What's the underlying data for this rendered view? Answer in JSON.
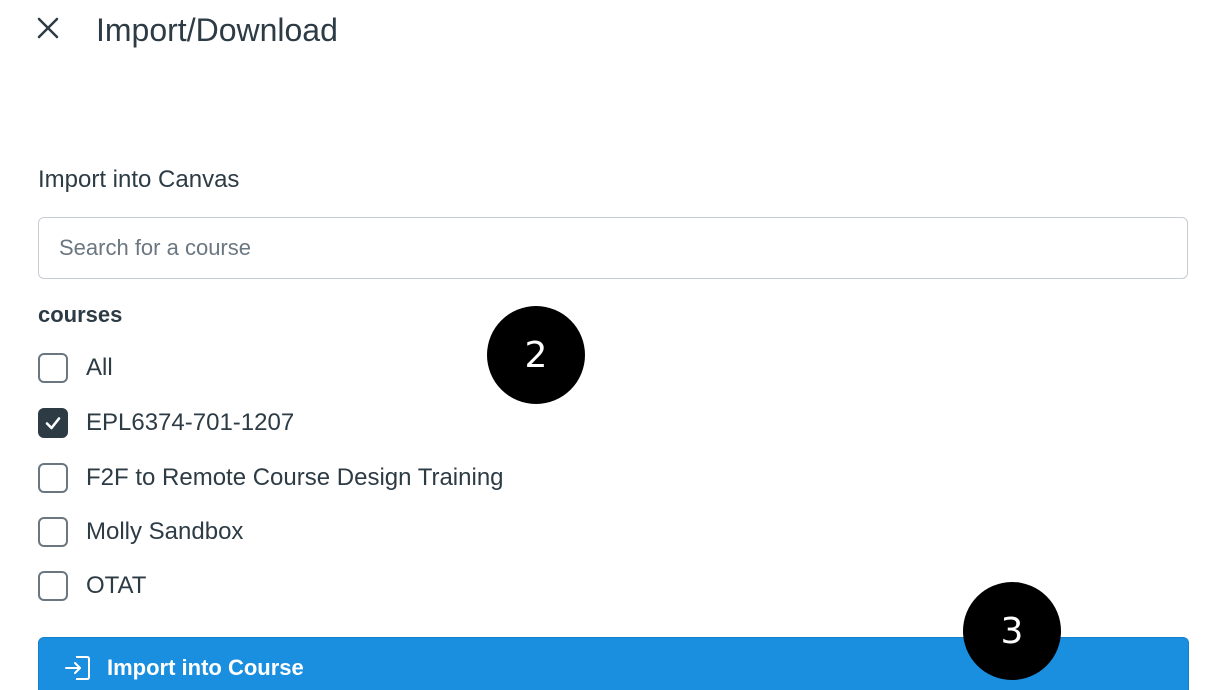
{
  "header": {
    "title": "Import/Download",
    "close_icon": "close-icon"
  },
  "import_section": {
    "label": "Import into Canvas",
    "search": {
      "placeholder": "Search for a course",
      "value": ""
    },
    "group_label": "courses",
    "courses": [
      {
        "label": "All",
        "checked": false
      },
      {
        "label": "EPL6374-701-1207",
        "checked": true
      },
      {
        "label": "F2F to Remote Course Design Training",
        "checked": false
      },
      {
        "label": "Molly Sandbox",
        "checked": false
      },
      {
        "label": "OTAT",
        "checked": false
      }
    ],
    "import_button": {
      "label": "Import into Course",
      "icon": "import-icon",
      "color": "#1a8fe0"
    }
  },
  "callouts": [
    "2",
    "3"
  ]
}
